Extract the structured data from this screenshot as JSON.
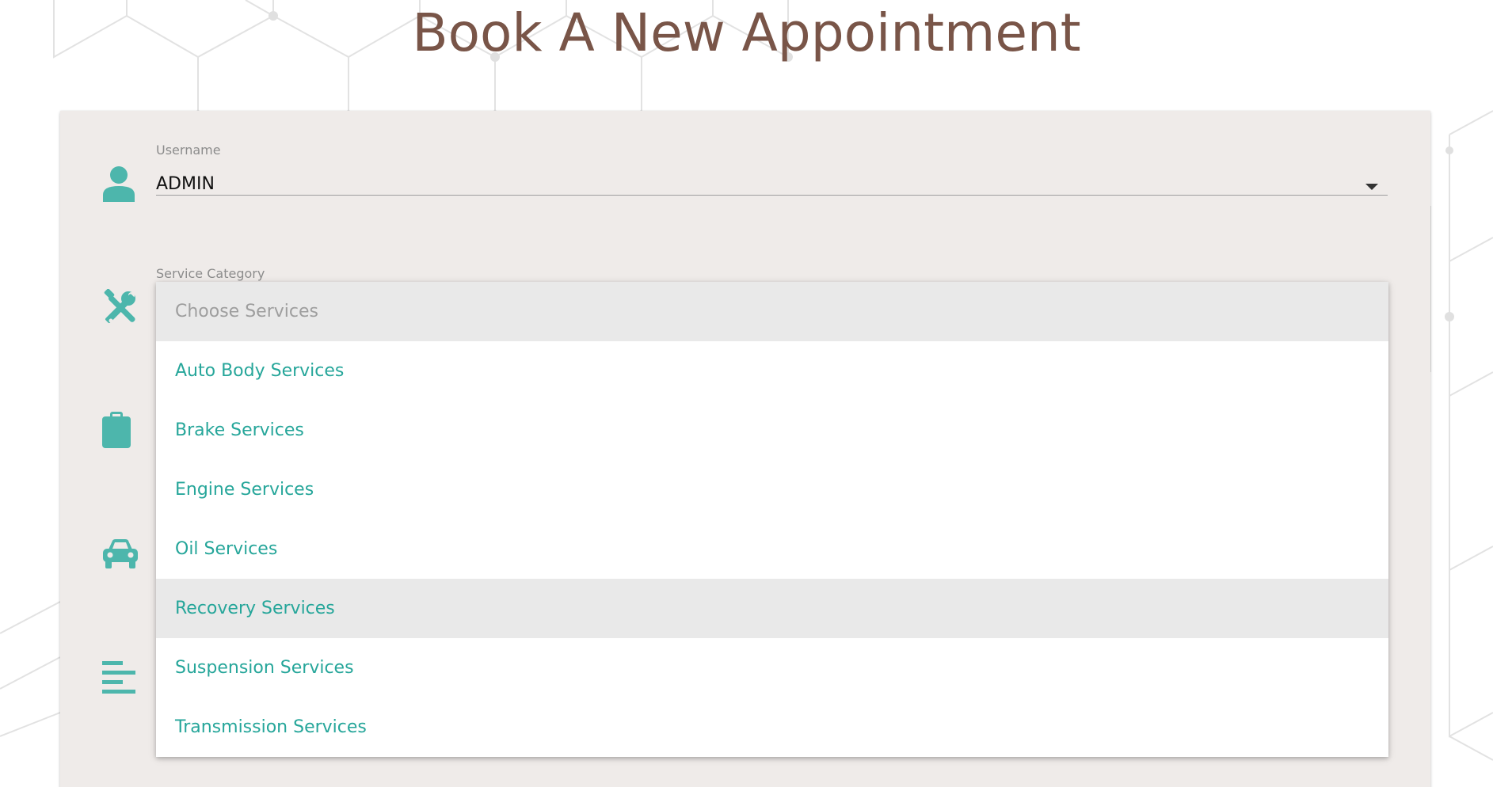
{
  "page": {
    "title": "Book A New Appointment"
  },
  "form": {
    "username": {
      "label": "Username",
      "value": "ADMIN",
      "icon": "person-icon"
    },
    "service_category": {
      "label": "Service Category",
      "icon": "tools-icon",
      "placeholder": "Choose Services",
      "options": [
        "Auto Body Services",
        "Brake Services",
        "Engine Services",
        "Oil Services",
        "Recovery Services",
        "Suspension Services",
        "Transmission Services"
      ],
      "highlighted_option": "Recovery Services"
    },
    "row_icons": [
      "clipboard-icon",
      "car-icon",
      "notes-icon"
    ]
  },
  "colors": {
    "title": "#795548",
    "accent": "#26a69a",
    "icon": "#4db6ac",
    "card_background": "#efebe9"
  }
}
